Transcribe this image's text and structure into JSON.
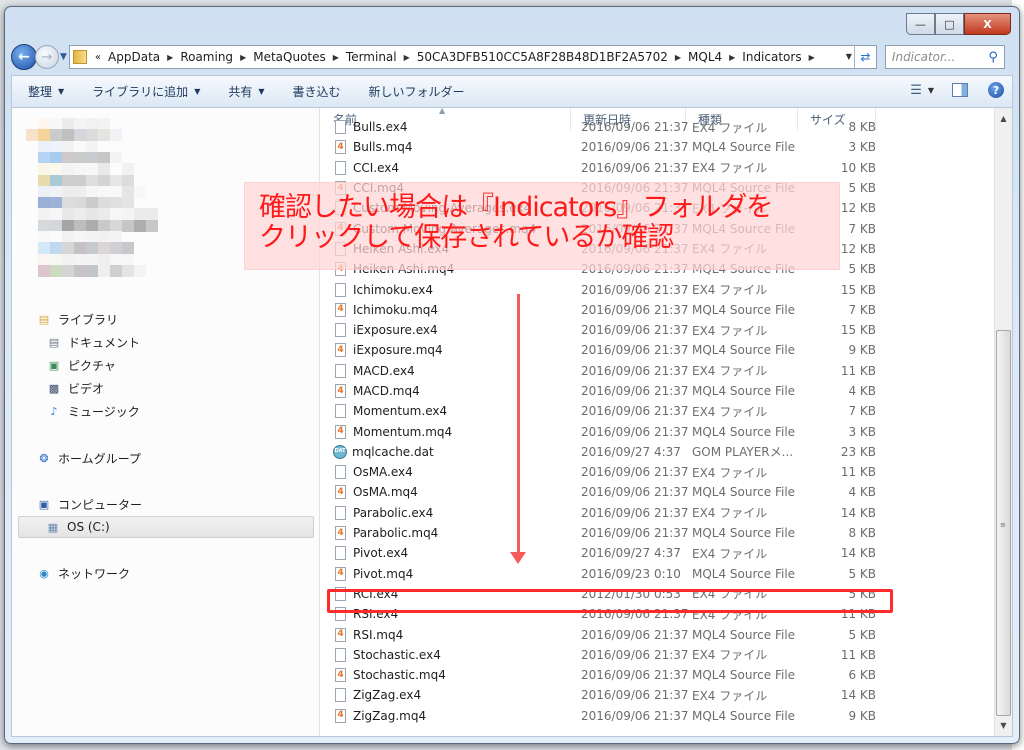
{
  "window": {
    "controls": {
      "minimize": "—",
      "maximize": "□",
      "close": "X"
    }
  },
  "navigation": {
    "back_icon": "back-arrow-icon",
    "forward_icon": "forward-arrow-icon",
    "overflow": "«",
    "breadcrumbs": [
      "AppData",
      "Roaming",
      "MetaQuotes",
      "Terminal",
      "50CA3DFB510CC5A8F28B48D1BF2A5702",
      "MQL4",
      "Indicators"
    ],
    "search_placeholder": "Indicator..."
  },
  "toolbar": {
    "items": [
      {
        "label": "整理",
        "dropdown": true
      },
      {
        "label": "ライブラリに追加",
        "dropdown": true
      },
      {
        "label": "共有",
        "dropdown": true
      },
      {
        "label": "書き込む",
        "dropdown": false
      },
      {
        "label": "新しいフォルダー",
        "dropdown": false
      }
    ]
  },
  "sidebar": {
    "items": [
      {
        "label": "ライブラリ",
        "icon": "library-folder-icon",
        "indent": 0
      },
      {
        "label": "ドキュメント",
        "icon": "document-icon",
        "indent": 1
      },
      {
        "label": "ピクチャ",
        "icon": "picture-icon",
        "indent": 1
      },
      {
        "label": "ビデオ",
        "icon": "video-icon",
        "indent": 1
      },
      {
        "label": "ミュージック",
        "icon": "music-note-icon",
        "indent": 1
      },
      {
        "label": "ホームグループ",
        "icon": "homegroup-icon",
        "indent": 0
      },
      {
        "label": "コンピューター",
        "icon": "computer-icon",
        "indent": 0
      },
      {
        "label": "OS (C:)",
        "icon": "drive-icon",
        "indent": 1,
        "selected": true
      },
      {
        "label": "ネットワーク",
        "icon": "network-icon",
        "indent": 0
      }
    ]
  },
  "columns": {
    "name": "名前",
    "date": "更新日時",
    "type": "種類",
    "size": "サイズ"
  },
  "files": [
    {
      "name": "Bulls.ex4",
      "date": "2016/09/06 21:37",
      "type": "EX4 ファイル",
      "size": "8 KB",
      "kind": "ex4"
    },
    {
      "name": "Bulls.mq4",
      "date": "2016/09/06 21:37",
      "type": "MQL4 Source File",
      "size": "3 KB",
      "kind": "mq4"
    },
    {
      "name": "CCI.ex4",
      "date": "2016/09/06 21:37",
      "type": "EX4 ファイル",
      "size": "10 KB",
      "kind": "ex4"
    },
    {
      "name": "CCI.mq4",
      "date": "2016/09/06 21:37",
      "type": "MQL4 Source File",
      "size": "5 KB",
      "kind": "mq4"
    },
    {
      "name": "Custom Moving Averages.ex4",
      "date": "2016/09/06 21:37",
      "type": "EX4 ファイル",
      "size": "12 KB",
      "kind": "ex4"
    },
    {
      "name": "Custom Moving Averages.mq4",
      "date": "2016/09/06 21:37",
      "type": "MQL4 Source File",
      "size": "7 KB",
      "kind": "mq4"
    },
    {
      "name": "Heiken Ashi.ex4",
      "date": "2016/09/06 21:37",
      "type": "EX4 ファイル",
      "size": "12 KB",
      "kind": "ex4"
    },
    {
      "name": "Heiken Ashi.mq4",
      "date": "2016/09/06 21:37",
      "type": "MQL4 Source File",
      "size": "5 KB",
      "kind": "mq4"
    },
    {
      "name": "Ichimoku.ex4",
      "date": "2016/09/06 21:37",
      "type": "EX4 ファイル",
      "size": "15 KB",
      "kind": "ex4"
    },
    {
      "name": "Ichimoku.mq4",
      "date": "2016/09/06 21:37",
      "type": "MQL4 Source File",
      "size": "7 KB",
      "kind": "mq4"
    },
    {
      "name": "iExposure.ex4",
      "date": "2016/09/06 21:37",
      "type": "EX4 ファイル",
      "size": "15 KB",
      "kind": "ex4"
    },
    {
      "name": "iExposure.mq4",
      "date": "2016/09/06 21:37",
      "type": "MQL4 Source File",
      "size": "9 KB",
      "kind": "mq4"
    },
    {
      "name": "MACD.ex4",
      "date": "2016/09/06 21:37",
      "type": "EX4 ファイル",
      "size": "11 KB",
      "kind": "ex4"
    },
    {
      "name": "MACD.mq4",
      "date": "2016/09/06 21:37",
      "type": "MQL4 Source File",
      "size": "4 KB",
      "kind": "mq4"
    },
    {
      "name": "Momentum.ex4",
      "date": "2016/09/06 21:37",
      "type": "EX4 ファイル",
      "size": "7 KB",
      "kind": "ex4"
    },
    {
      "name": "Momentum.mq4",
      "date": "2016/09/06 21:37",
      "type": "MQL4 Source File",
      "size": "3 KB",
      "kind": "mq4"
    },
    {
      "name": "mqlcache.dat",
      "date": "2016/09/27 4:37",
      "type": "GOM PLAYERメ...",
      "size": "23 KB",
      "kind": "dat"
    },
    {
      "name": "OsMA.ex4",
      "date": "2016/09/06 21:37",
      "type": "EX4 ファイル",
      "size": "11 KB",
      "kind": "ex4"
    },
    {
      "name": "OsMA.mq4",
      "date": "2016/09/06 21:37",
      "type": "MQL4 Source File",
      "size": "4 KB",
      "kind": "mq4"
    },
    {
      "name": "Parabolic.ex4",
      "date": "2016/09/06 21:37",
      "type": "EX4 ファイル",
      "size": "14 KB",
      "kind": "ex4"
    },
    {
      "name": "Parabolic.mq4",
      "date": "2016/09/06 21:37",
      "type": "MQL4 Source File",
      "size": "8 KB",
      "kind": "mq4"
    },
    {
      "name": "Pivot.ex4",
      "date": "2016/09/27 4:37",
      "type": "EX4 ファイル",
      "size": "14 KB",
      "kind": "ex4"
    },
    {
      "name": "Pivot.mq4",
      "date": "2016/09/23 0:10",
      "type": "MQL4 Source File",
      "size": "5 KB",
      "kind": "mq4"
    },
    {
      "name": "RCI.ex4",
      "date": "2012/01/30 0:53",
      "type": "EX4 ファイル",
      "size": "5 KB",
      "kind": "ex4",
      "highlighted": true
    },
    {
      "name": "RSI.ex4",
      "date": "2016/09/06 21:37",
      "type": "EX4 ファイル",
      "size": "11 KB",
      "kind": "ex4"
    },
    {
      "name": "RSI.mq4",
      "date": "2016/09/06 21:37",
      "type": "MQL4 Source File",
      "size": "5 KB",
      "kind": "mq4"
    },
    {
      "name": "Stochastic.ex4",
      "date": "2016/09/06 21:37",
      "type": "EX4 ファイル",
      "size": "11 KB",
      "kind": "ex4"
    },
    {
      "name": "Stochastic.mq4",
      "date": "2016/09/06 21:37",
      "type": "MQL4 Source File",
      "size": "6 KB",
      "kind": "mq4"
    },
    {
      "name": "ZigZag.ex4",
      "date": "2016/09/06 21:37",
      "type": "EX4 ファイル",
      "size": "14 KB",
      "kind": "ex4"
    },
    {
      "name": "ZigZag.mq4",
      "date": "2016/09/06 21:37",
      "type": "MQL4 Source File",
      "size": "9 KB",
      "kind": "mq4"
    }
  ],
  "annotation": {
    "line1": "確認したい場合は『Indicators』フォルダを",
    "line2": "クリックして保存されているか確認",
    "color": "#ff1a1a",
    "arrow_color": "#f75a5a",
    "highlight_color": "#ff2b2b"
  }
}
